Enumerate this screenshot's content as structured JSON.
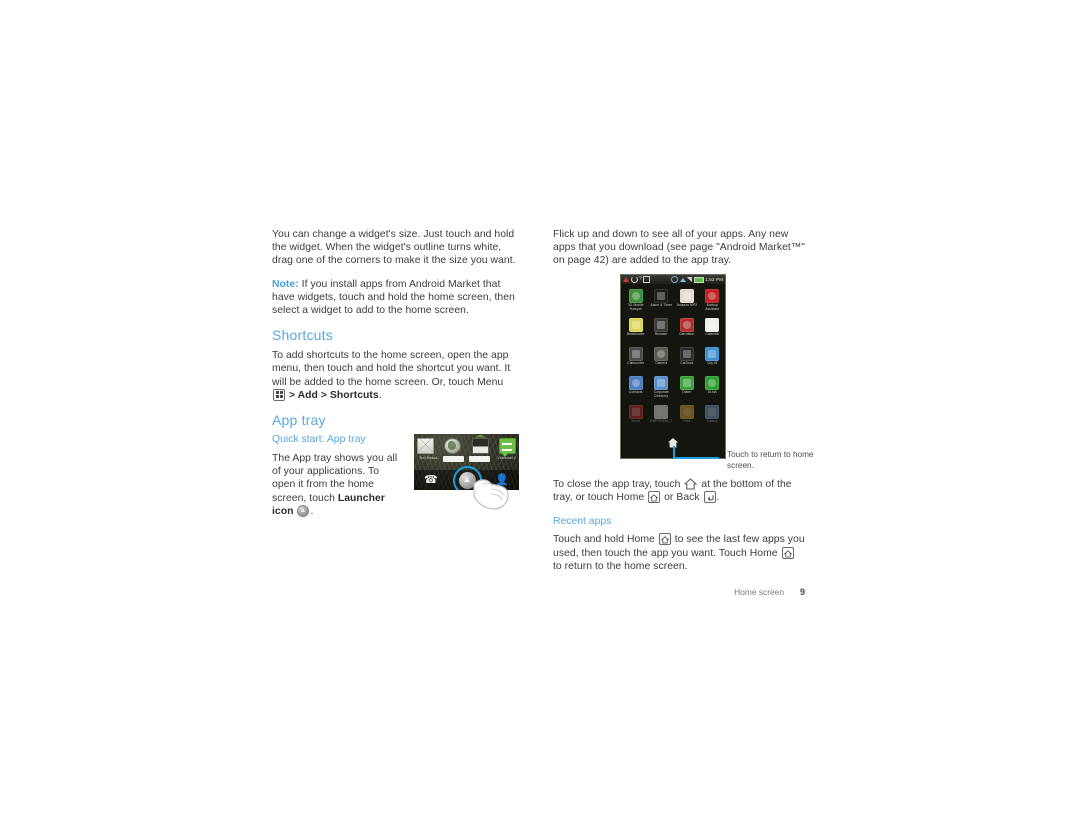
{
  "left_column": {
    "para1": "You can change a widget's size. Just touch and hold the widget. When the widget's outline turns white, drag one of the corners to make it the size you want.",
    "note_label": "Note:",
    "note_text": " If you install apps from Android Market that have widgets, touch and hold the home screen, then select a widget to add to the home screen.",
    "shortcuts_heading": "Shortcuts",
    "shortcuts_para_a": "To add shortcuts to the home screen, open the app menu, then touch and hold the shortcut you want. It will be added to the home screen. Or, touch Menu",
    "shortcuts_para_b": "> Add > Shortcuts",
    "shortcuts_para_c": ".",
    "apptray_heading": "App tray",
    "quickstart_heading": "Quick start: App tray",
    "apptray_para_a": "The App tray shows you all of your applications. To open it from the home screen, touch ",
    "apptray_para_bold": "Launcher icon",
    "apptray_para_c": "."
  },
  "home_screenshot": {
    "labels": [
      "Text Messa...",
      "Voicemail 2"
    ],
    "icons": [
      "mail-icon",
      "browser-globe-icon",
      "camera-tray-icon",
      "voicemail-icon"
    ],
    "dock": [
      "phone-icon",
      "launcher-icon",
      "contacts-icon"
    ]
  },
  "right_column": {
    "para1": "Flick up and down to see all of your apps. Any new apps that you download (see page \"Android Market™\" on page 42) are added to the app tray.",
    "close_para_a": "To close the app tray, touch ",
    "close_para_b": " at the bottom of the tray, or touch Home ",
    "close_para_c": " or Back ",
    "close_para_d": ".",
    "recent_heading": "Recent apps",
    "recent_para_a": "Touch and hold Home ",
    "recent_para_b": " to see the last few apps you used, then touch the app you want. Touch Home ",
    "recent_para_c": " to return to the home screen."
  },
  "phone_screenshot": {
    "status_bar": {
      "time": "1:53 PM",
      "left_icons": [
        "warning-icon",
        "sync-icon",
        "question-icon",
        "sd-card-icon"
      ],
      "right_icons": [
        "bluetooth-icon",
        "wifi-icon",
        "signal-icon",
        "battery-icon"
      ]
    },
    "apps": [
      {
        "label": "3G Mobile Hotspot",
        "color": "#3c8f3c",
        "glyph": "wifi"
      },
      {
        "label": "Alarm & Timer",
        "color": "#1c1c1c",
        "glyph": "alarm"
      },
      {
        "label": "Amazon MP3",
        "color": "#dedbd0",
        "glyph": "mp3"
      },
      {
        "label": "Backup Assistant",
        "color": "#c02020",
        "glyph": "backup"
      },
      {
        "label": "Blockbuster",
        "color": "#dcd65a",
        "glyph": "film"
      },
      {
        "label": "Browser",
        "color": "#3a3a3a",
        "glyph": "globe"
      },
      {
        "label": "Calculator",
        "color": "#b03030",
        "glyph": "calc"
      },
      {
        "label": "Calendar",
        "color": "#f0f0ea",
        "glyph": "cal31"
      },
      {
        "label": "Camcorder",
        "color": "#4a4a4a",
        "glyph": "camcorder"
      },
      {
        "label": "Camera",
        "color": "#5a5a52",
        "glyph": "camera"
      },
      {
        "label": "CarDock",
        "color": "#2a2a2a",
        "glyph": "cardock"
      },
      {
        "label": "City ID",
        "color": "#3e8fd0",
        "glyph": "cityid"
      },
      {
        "label": "Contacts",
        "color": "#4d7fc0",
        "glyph": "contacts"
      },
      {
        "label": "Corporate Directory",
        "color": "#5a8fc8",
        "glyph": "directory"
      },
      {
        "label": "Dialer",
        "color": "#3c9e3c",
        "glyph": "dialer"
      },
      {
        "label": "DLNA",
        "color": "#2fa02f",
        "glyph": "dlna"
      },
      {
        "label": "Droid",
        "color": "#c03030",
        "glyph": "droid"
      },
      {
        "label": "EMERGENCY",
        "color": "#e8e8e2",
        "glyph": "cross"
      },
      {
        "label": "Files",
        "color": "#d6a040",
        "glyph": "files"
      },
      {
        "label": "Gallery",
        "color": "#7aa0c0",
        "glyph": "gallery"
      }
    ],
    "home_button": "home-icon"
  },
  "callout": {
    "text": "Touch to return to home screen."
  },
  "footer": {
    "section": "Home screen",
    "page": "9"
  },
  "colors": {
    "heading_blue": "#5ba8de",
    "accent_blue": "#1a9fe0",
    "body_text": "#3c3c3c"
  }
}
